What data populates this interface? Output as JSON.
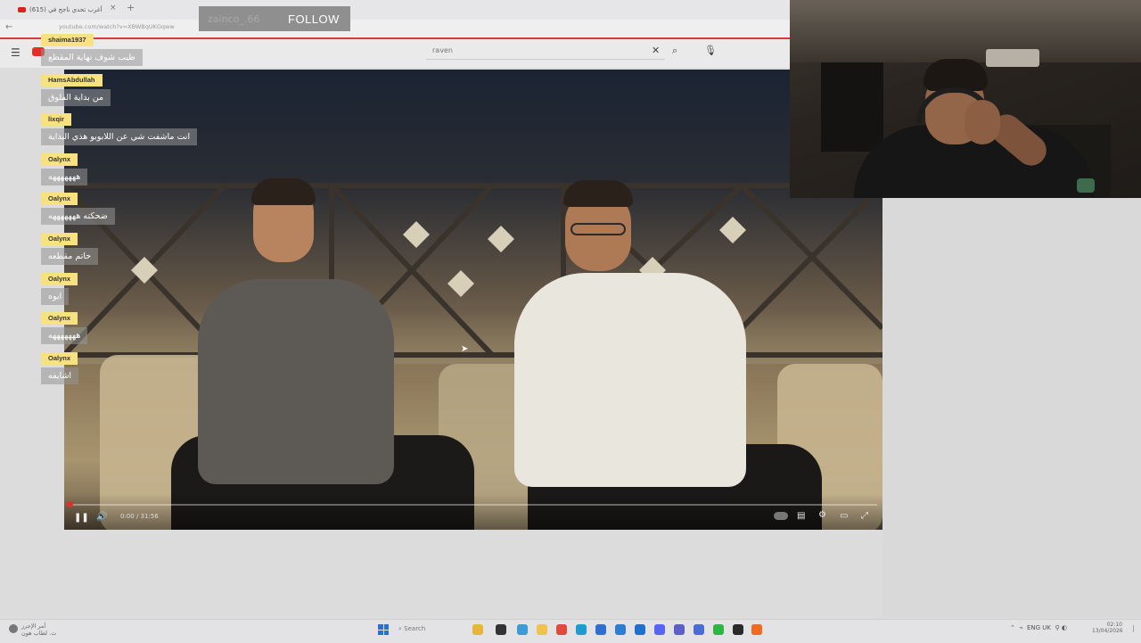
{
  "browser": {
    "tab_title": "(615) أغرب تحدي ناجح في",
    "tab_close": "×",
    "new_tab": "+",
    "url": "youtube.com/watch?v=XBWBqUKGqww",
    "back": "←"
  },
  "youtube": {
    "search_value": "raven",
    "search_clear": "✕",
    "search_icon": "⌕",
    "mic_icon": "🎙",
    "menu_icon": "☰"
  },
  "follow_overlay": {
    "name": "zainco_.66",
    "label": "FOLLOW"
  },
  "chat": [
    {
      "user": "shaima1937",
      "message": "طيب شوف نهاية المقطع"
    },
    {
      "user": "HamsAbdullah",
      "message": "من بداية الفلوق"
    },
    {
      "user": "lixqir",
      "message": "انت ماشفت شي عن اللابوبو هذي البداية"
    },
    {
      "user": "Oalynx",
      "message": "هههههههه"
    },
    {
      "user": "Oalynx",
      "message": "ضحكته هههههههه"
    },
    {
      "user": "Oalynx",
      "message": "حاتم مقطعه"
    },
    {
      "user": "Oalynx",
      "message": "ايوه"
    },
    {
      "user": "Oalynx",
      "message": "هههههههه"
    },
    {
      "user": "Oalynx",
      "message": "اشايفه"
    }
  ],
  "player": {
    "time": "0:00 / 31:56",
    "progress": 0.003,
    "play_icon": "❚❚",
    "volume_icon": "🔊",
    "subtitles_icon": "▤",
    "settings_icon": "⚙",
    "miniplayer_icon": "▭",
    "fullscreen_icon": "⤢"
  },
  "taskbar": {
    "weather_line1": "أمر الإجرز",
    "weather_line2": "ت. لطاب هون",
    "search_placeholder": "Search",
    "tray_text": "ENG UK",
    "clock_time": "02:10",
    "clock_date": "13/04/2026",
    "apps": [
      {
        "icon": "file-explorer-icon",
        "color": "#e8b53b"
      },
      {
        "icon": "terminal-icon",
        "color": "#333333"
      },
      {
        "icon": "photos-icon",
        "color": "#3a9bd5"
      },
      {
        "icon": "folder-icon",
        "color": "#f0c44c"
      },
      {
        "icon": "chrome-icon",
        "color": "#e04a3a"
      },
      {
        "icon": "edge-icon",
        "color": "#1f9bd1"
      },
      {
        "icon": "store-icon",
        "color": "#2f6fcf"
      },
      {
        "icon": "mail-icon",
        "color": "#2a7fd4"
      },
      {
        "icon": "onedrive-icon",
        "color": "#1f6fd1"
      },
      {
        "icon": "discord-icon",
        "color": "#5865f2"
      },
      {
        "icon": "teams-icon",
        "color": "#5b5fc7"
      },
      {
        "icon": "settings-icon",
        "color": "#4a6cd4"
      },
      {
        "icon": "whatsapp-icon",
        "color": "#2cb742"
      },
      {
        "icon": "obs-icon",
        "color": "#2a2a2a"
      },
      {
        "icon": "green-app-icon",
        "color": "#1f8f4f"
      },
      {
        "icon": "brave-icon",
        "color": "#f06a1f"
      }
    ]
  },
  "colors": {
    "chat_user_bg": "#f7e27f",
    "youtube_red": "#e52d27",
    "taskbar_bg": "#e3e3e5"
  }
}
